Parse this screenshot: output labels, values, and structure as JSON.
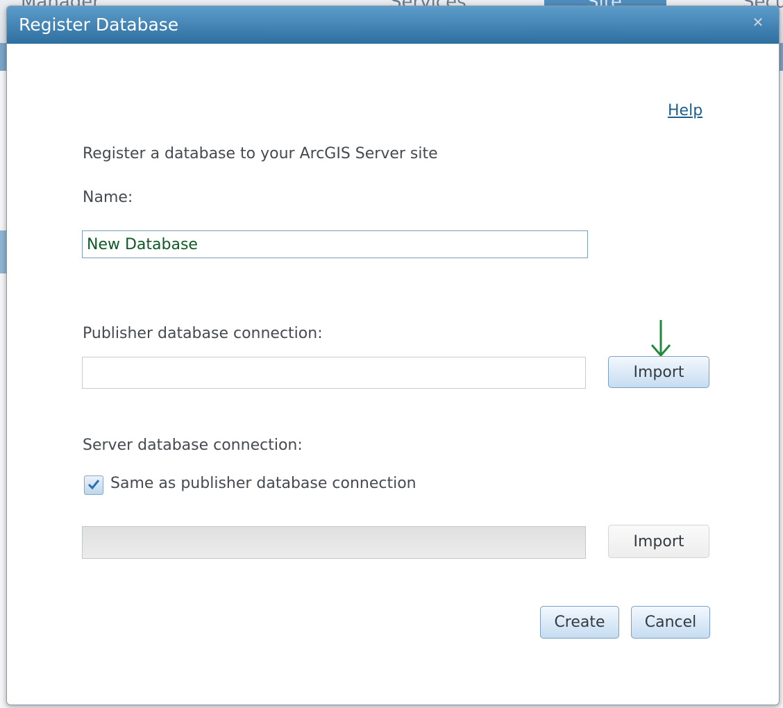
{
  "background": {
    "nav_left_text": "Manager",
    "nav_mid_text": "Services",
    "nav_active_text": "Site",
    "nav_right_text": "Secu"
  },
  "dialog": {
    "title": "Register Database",
    "close_icon": "close-icon",
    "help_label": "Help",
    "intro": "Register a database to your ArcGIS Server site",
    "name_label": "Name:",
    "name_value": "New Database",
    "publisher_label": "Publisher database connection:",
    "publisher_value": "",
    "import_label": "Import",
    "server_label": "Server database connection:",
    "same_as_label": "Same as publisher database connection",
    "same_as_checked": true,
    "server_value": "",
    "server_import_label": "Import",
    "create_label": "Create",
    "cancel_label": "Cancel"
  },
  "annotation": {
    "arrow_icon": "down-arrow-icon",
    "arrow_color": "#1e8a3a"
  },
  "colors": {
    "title_bar": "#2d6f9f",
    "link": "#1d5f8c",
    "name_text": "#0e5a26"
  }
}
